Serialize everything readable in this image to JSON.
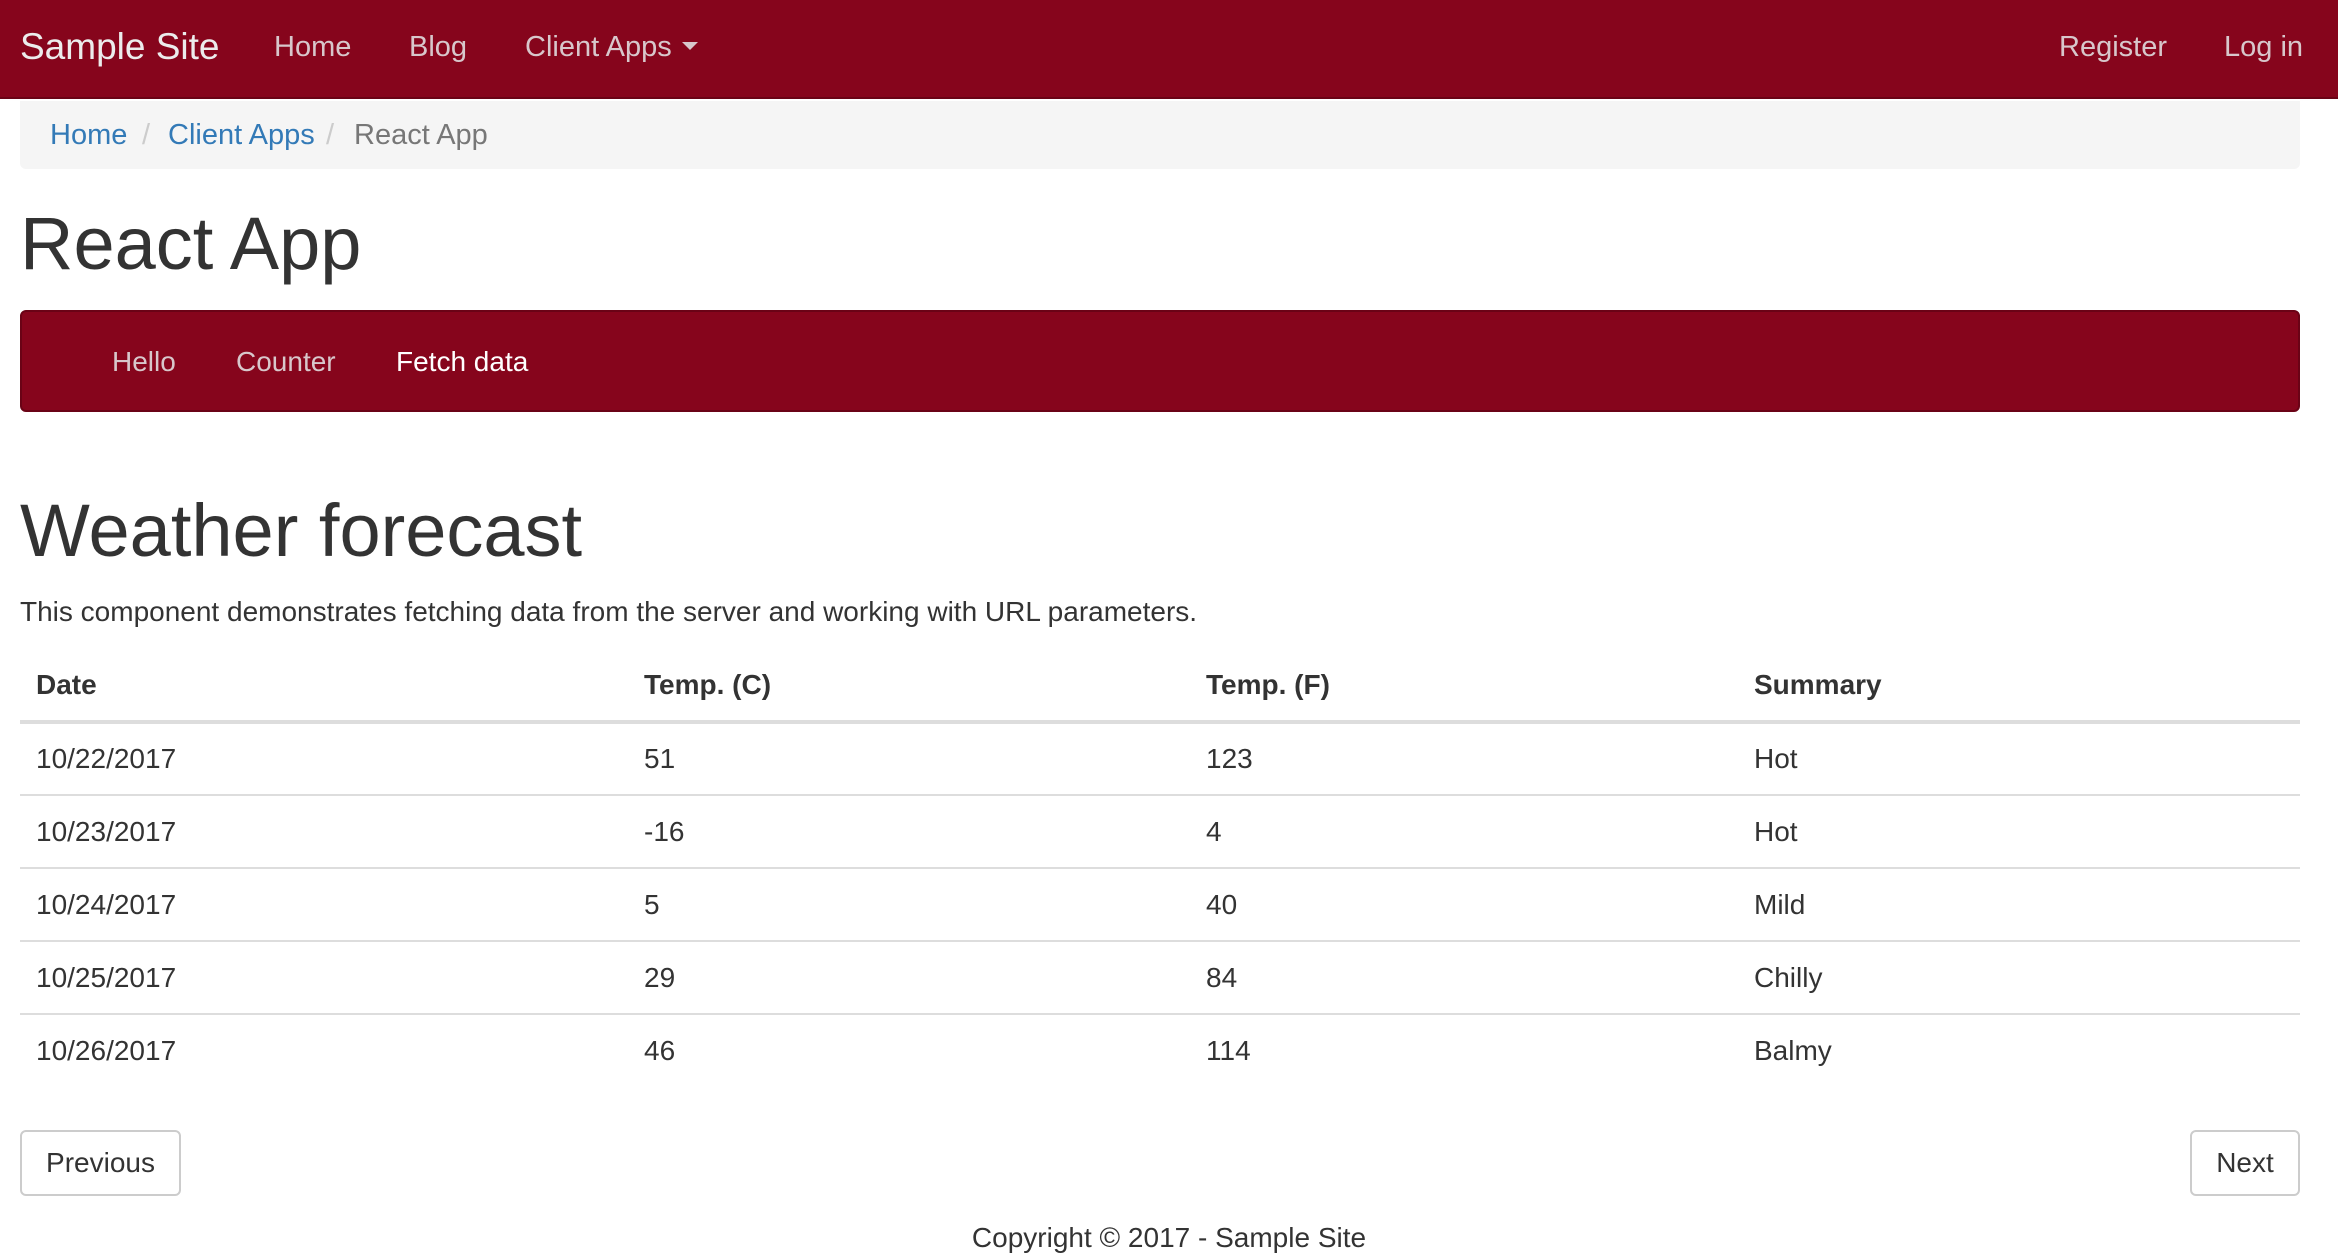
{
  "topnav": {
    "brand": "Sample Site",
    "links": [
      "Home",
      "Blog",
      "Client Apps"
    ],
    "right_links": [
      "Register",
      "Log in"
    ],
    "background": "#86051c"
  },
  "breadcrumb": {
    "items": [
      "Home",
      "Client Apps"
    ],
    "separator": "/",
    "active": "React App"
  },
  "page_title": "React App",
  "app_nav": {
    "tabs": [
      "Hello",
      "Counter",
      "Fetch data"
    ],
    "active_tab": "Fetch data"
  },
  "section": {
    "title": "Weather forecast",
    "description": "This component demonstrates fetching data from the server and working with URL parameters."
  },
  "table": {
    "headers": [
      "Date",
      "Temp. (C)",
      "Temp. (F)",
      "Summary"
    ],
    "rows": [
      [
        "10/22/2017",
        "51",
        "123",
        "Hot"
      ],
      [
        "10/23/2017",
        "-16",
        "4",
        "Hot"
      ],
      [
        "10/24/2017",
        "5",
        "40",
        "Mild"
      ],
      [
        "10/25/2017",
        "29",
        "84",
        "Chilly"
      ],
      [
        "10/26/2017",
        "46",
        "114",
        "Balmy"
      ]
    ]
  },
  "pager": {
    "previous": "Previous",
    "next": "Next"
  },
  "footer": "Copyright © 2017 - Sample Site"
}
